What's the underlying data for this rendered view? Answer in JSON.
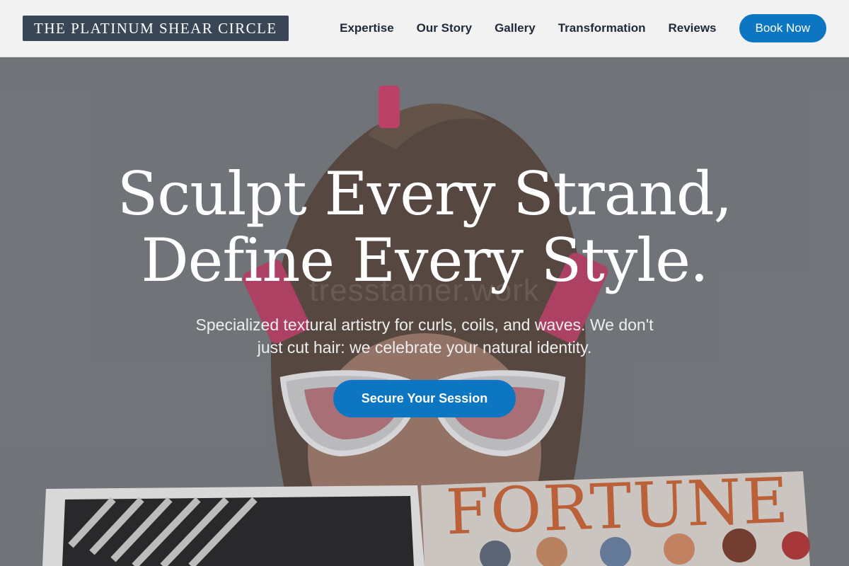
{
  "brand": {
    "name": "THE PLATINUM SHEAR CIRCLE"
  },
  "nav": {
    "links": [
      "Expertise",
      "Our Story",
      "Gallery",
      "Transformation",
      "Reviews"
    ],
    "cta_label": "Book Now"
  },
  "hero": {
    "headline_line1": "Sculpt Every Strand,",
    "headline_line2": "Define Every Style.",
    "subtext": "Specialized textural artistry for curls, coils, and waves. We don't just cut hair: we celebrate your natural identity.",
    "cta_label": "Secure Your Session",
    "magazine_title": "FORTUNE",
    "watermark": "tresstamer.work"
  },
  "colors": {
    "accent": "#0c76c3",
    "brand_bg": "#3a4556",
    "nav_bg": "#f2f2f2",
    "nav_text": "#1f2a3a"
  }
}
